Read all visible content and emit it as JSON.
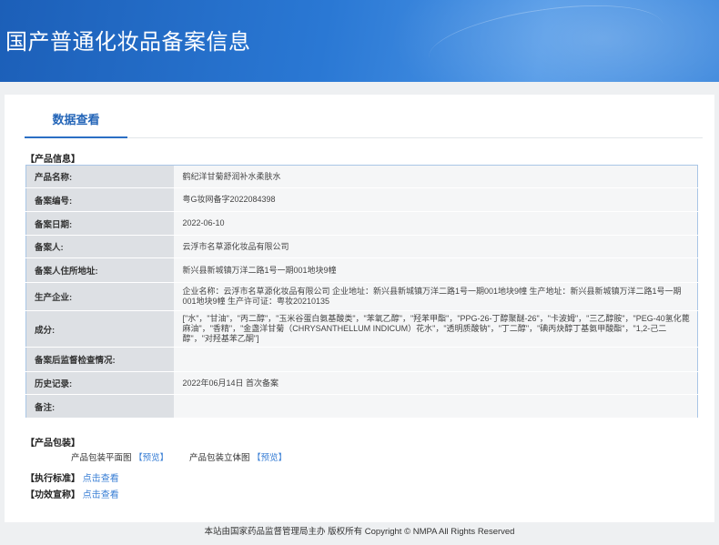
{
  "header": {
    "title": "国产普通化妆品备案信息"
  },
  "tabs": [
    {
      "label": "数据查看"
    }
  ],
  "product_info": {
    "section_label": "【产品信息】",
    "rows": [
      {
        "key": "产品名称:",
        "value": "鹤纪洋甘菊舒润补水柔肤水"
      },
      {
        "key": "备案编号:",
        "value": "粤G妆网备字2022084398"
      },
      {
        "key": "备案日期:",
        "value": "2022-06-10"
      },
      {
        "key": "备案人:",
        "value": "云浮市名草源化妆品有限公司"
      },
      {
        "key": "备案人住所地址:",
        "value": "新兴县新城镇万洋二路1号一期001地块9幢"
      },
      {
        "key": "生产企业:",
        "value": "企业名称：云浮市名草源化妆品有限公司 企业地址：新兴县新城镇万洋二路1号一期001地块9幢 生产地址：新兴县新城镇万洋二路1号一期001地块9幢 生产许可证：粤妆20210135"
      },
      {
        "key": "成分:",
        "value": "[\"水\"，\"甘油\"，\"丙二醇\"，\"玉米谷蛋白氨基酸类\"，\"苯氧乙醇\"，\"羟苯甲酯\"，\"PPG-26-丁醇聚醚-26\"，\"卡波姆\"，\"三乙醇胺\"，\"PEG-40氢化蓖麻油\"，\"香精\"，\"金盏洋甘菊（CHRYSANTHELLUM INDICUM）花水\"，\"透明质酸钠\"，\"丁二醇\"，\"碘丙炔醇丁基氨甲酸酯\"，\"1,2-己二醇\"，\"对羟基苯乙酮\"]"
      },
      {
        "key": "备案后监督检查情况:",
        "value": ""
      },
      {
        "key": "历史记录:",
        "value": "2022年06月14日 首次备案"
      },
      {
        "key": "备注:",
        "value": ""
      }
    ]
  },
  "packaging": {
    "section_label": "【产品包装】",
    "flat_label": "产品包装平面图",
    "flat_link": "【预览】",
    "solid_label": "产品包装立体图",
    "solid_link": "【预览】"
  },
  "standard": {
    "section_label": "【执行标准】",
    "link": "点击查看"
  },
  "efficacy": {
    "section_label": "【功效宣称】",
    "link": "点击查看"
  },
  "footer": {
    "text": "本站由国家药品监督管理局主办 版权所有 Copyright © NMPA All Rights Reserved"
  }
}
